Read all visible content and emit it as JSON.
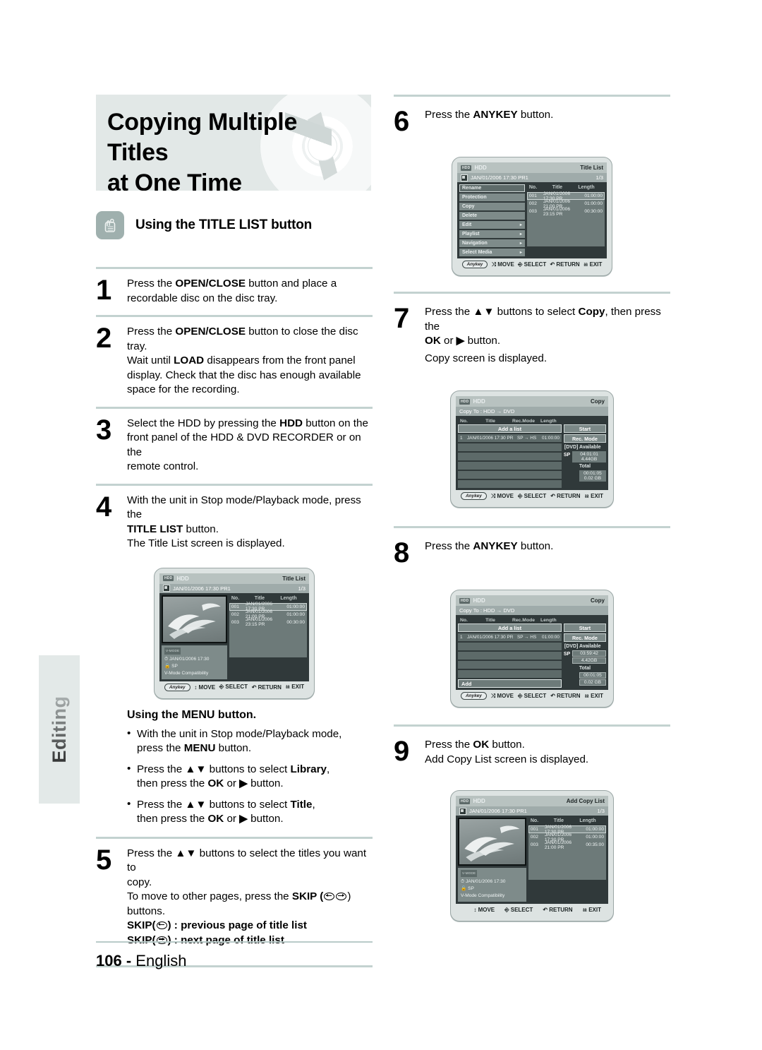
{
  "page": {
    "side_tab_label": "Editing",
    "footer_page": "106 -",
    "footer_lang": "English"
  },
  "banner": {
    "title_line1": "Copying Multiple Titles",
    "title_line2": "at One Time"
  },
  "section": {
    "icon": "hand-press-icon",
    "title": "Using the TITLE LIST button"
  },
  "steps_left": [
    {
      "num": "1",
      "lines": [
        [
          {
            "t": "Press the "
          },
          {
            "t": "OPEN/CLOSE",
            "b": true
          },
          {
            "t": " button and place a"
          }
        ],
        [
          {
            "t": "recordable disc on the disc tray."
          }
        ]
      ]
    },
    {
      "num": "2",
      "lines": [
        [
          {
            "t": "Press the "
          },
          {
            "t": "OPEN/CLOSE",
            "b": true
          },
          {
            "t": " button to close the disc tray."
          }
        ],
        [
          {
            "t": "Wait until "
          },
          {
            "t": "LOAD",
            "b": true
          },
          {
            "t": " disappears from the front panel"
          }
        ],
        [
          {
            "t": "display. Check that the disc has enough available"
          }
        ],
        [
          {
            "t": "space for the recording."
          }
        ]
      ]
    },
    {
      "num": "3",
      "lines": [
        [
          {
            "t": "Select the HDD by pressing the "
          },
          {
            "t": "HDD",
            "b": true
          },
          {
            "t": " button on the"
          }
        ],
        [
          {
            "t": "front panel of the HDD & DVD RECORDER or on the"
          }
        ],
        [
          {
            "t": "remote control."
          }
        ]
      ]
    },
    {
      "num": "4",
      "lines": [
        [
          {
            "t": "With the unit in Stop mode/Playback mode, press the"
          }
        ],
        [
          {
            "t": "TITLE LIST",
            "b": true
          },
          {
            "t": " button."
          }
        ],
        [
          {
            "t": "The Title List screen is displayed."
          }
        ]
      ]
    }
  ],
  "menu_section": {
    "heading": "Using the MENU button.",
    "bullets": [
      [
        {
          "t": "With the unit in Stop mode/Playback mode,"
        },
        {
          "br": true
        },
        {
          "t": "press the "
        },
        {
          "t": "MENU",
          "b": true
        },
        {
          "t": " button."
        }
      ],
      [
        {
          "t": "Press the "
        },
        {
          "t": "▲▼",
          "b": true
        },
        {
          "t": " buttons to select "
        },
        {
          "t": "Library",
          "b": true
        },
        {
          "t": ","
        },
        {
          "br": true
        },
        {
          "t": "then press the "
        },
        {
          "t": "OK",
          "b": true
        },
        {
          "t": " or "
        },
        {
          "t": "▶",
          "b": true
        },
        {
          "t": " button."
        }
      ],
      [
        {
          "t": "Press the "
        },
        {
          "t": "▲▼",
          "b": true
        },
        {
          "t": " buttons to select "
        },
        {
          "t": "Title",
          "b": true
        },
        {
          "t": ","
        },
        {
          "br": true
        },
        {
          "t": "then press the "
        },
        {
          "t": "OK",
          "b": true
        },
        {
          "t": " or "
        },
        {
          "t": "▶",
          "b": true
        },
        {
          "t": " button."
        }
      ]
    ]
  },
  "step5": {
    "num": "5",
    "l1a": "Press the ",
    "l1b": "▲▼",
    "l1c": " buttons to select the titles you want to",
    "l2": "copy.",
    "l3a": "To move to other pages, press the ",
    "l3b": "SKIP (",
    "l3c": ")",
    "l4": "buttons.",
    "l5a": "SKIP(",
    "l5b": ") : previous page of title list",
    "l6a": "SKIP(",
    "l6b": ") : next page of title list"
  },
  "steps_right": [
    {
      "num": "6",
      "lines": [
        [
          {
            "t": "Press the "
          },
          {
            "t": "ANYKEY",
            "b": true
          },
          {
            "t": " button."
          }
        ]
      ]
    },
    {
      "num": "7",
      "lines": [
        [
          {
            "t": "Press the "
          },
          {
            "t": "▲▼",
            "b": true
          },
          {
            "t": " buttons to select "
          },
          {
            "t": "Copy",
            "b": true
          },
          {
            "t": ", then press the"
          }
        ],
        [
          {
            "t": "OK",
            "b": true
          },
          {
            "t": " or "
          },
          {
            "t": "▶",
            "b": true
          },
          {
            "t": " button."
          }
        ],
        [
          {
            "t": "Copy screen is displayed."
          }
        ]
      ]
    },
    {
      "num": "8",
      "lines": [
        [
          {
            "t": "Press the "
          },
          {
            "t": "ANYKEY",
            "b": true
          },
          {
            "t": " button."
          }
        ]
      ]
    },
    {
      "num": "9",
      "lines": [
        [
          {
            "t": "Press the "
          },
          {
            "t": "OK",
            "b": true
          },
          {
            "t": " button."
          }
        ],
        [
          {
            "t": "Add Copy List screen is displayed."
          }
        ]
      ]
    }
  ],
  "osd_common": {
    "source": "HDD",
    "subtitle": "JAN/01/2006 17:30 PR1",
    "page_indicator": "1/3",
    "col_no": "No.",
    "col_title": "Title",
    "col_length": "Length",
    "anykey": "Anykey",
    "move": "MOVE",
    "select": "SELECT",
    "return": "RETURN",
    "exit": "EXIT",
    "vmode_chip": "V-MODE",
    "info_time": "JAN/01/2006 17:30",
    "info_rec": "SP",
    "info_compat": "V-Mode Compatibility"
  },
  "osd_titlelist": {
    "title": "Title List",
    "rows": [
      {
        "no": "001",
        "title": "JAN/01/2006 17:30 PR",
        "length": "01:00:00",
        "selected": true
      },
      {
        "no": "002",
        "title": "JAN/01/2006 21:00 PR",
        "length": "01:00:00",
        "selected": false
      },
      {
        "no": "003",
        "title": "JAN/01/2006 23:15 PR",
        "length": "00:30:00",
        "selected": false
      }
    ],
    "empty_rows": 4
  },
  "osd_anykey_menu": {
    "title": "Title List",
    "items": [
      {
        "label": "Rename",
        "arrow": false,
        "selected": true
      },
      {
        "label": "Protection",
        "arrow": false,
        "selected": false
      },
      {
        "label": "Copy",
        "arrow": false,
        "selected": false
      },
      {
        "label": "Delete",
        "arrow": false,
        "selected": false
      },
      {
        "label": "Edit",
        "arrow": true,
        "selected": false
      },
      {
        "label": "Playlist",
        "arrow": true,
        "selected": false
      },
      {
        "label": "Navigation",
        "arrow": true,
        "selected": false
      },
      {
        "label": "Select Media",
        "arrow": true,
        "selected": false
      }
    ],
    "rows": [
      {
        "no": "001",
        "title": "JAN/01/2006 17:30 PR",
        "length": "01:00:00",
        "selected": true
      },
      {
        "no": "002",
        "title": "JAN/01/2006 21:00 PR",
        "length": "01:00:00",
        "selected": false
      },
      {
        "no": "003",
        "title": "JAN/01/2006 23:15 PR",
        "length": "00:30:00",
        "selected": false
      }
    ],
    "empty_rows": 4
  },
  "osd_copy_7": {
    "title": "Copy",
    "copy_to": "Copy To : HDD → DVD",
    "col_no": "No.",
    "col_title": "Title",
    "col_recmode": "Rec.Mode",
    "col_length": "Length",
    "add_a_list": "Add a list",
    "item": {
      "no": "1",
      "title": "JAN/01/2006 17:30 PR",
      "recmode": "SP → HS",
      "length": "01:00:00"
    },
    "btn_start": "Start",
    "btn_recmode": "Rec. Mode",
    "available_label": "[DVD] Available",
    "available_mode": "SP",
    "available_time": "04:01:01",
    "available_size": "4.44GB",
    "total_label": "Total",
    "total_time": "00:01:05",
    "total_size": "0.02 GB",
    "blank_rows": 5
  },
  "osd_copy_8": {
    "title": "Copy",
    "copy_to": "Copy To : HDD → DVD",
    "col_no": "No.",
    "col_title": "Title",
    "col_recmode": "Rec.Mode",
    "col_length": "Length",
    "add_a_list": "Add a list",
    "item": {
      "no": "1",
      "title": "JAN/01/2006 17:30 PR",
      "recmode": "SP → HS",
      "length": "01:00:00"
    },
    "btn_start": "Start",
    "btn_recmode": "Rec. Mode",
    "available_label": "[DVD] Available",
    "available_mode": "SP",
    "available_time": "03:59:42",
    "available_size": "4.42GB",
    "total_label": "Total",
    "total_time": "00:01:05",
    "total_size": "0.02 GB",
    "add_popup": "Add",
    "blank_rows": 4
  },
  "osd_addcopylist": {
    "title": "Add Copy List",
    "rows": [
      {
        "no": "001",
        "title": "JAN/01/2006 17:30 PR",
        "length": "01:00:00",
        "selected": true
      },
      {
        "no": "002",
        "title": "JAN/01/2006 17:30 PR",
        "length": "01:00:00",
        "selected": false
      },
      {
        "no": "003",
        "title": "JAN/01/2006 21:00 PR",
        "length": "00:35:00",
        "selected": false
      }
    ],
    "empty_rows": 4
  },
  "colors": {
    "banner_bg": "#e2e8e7",
    "rule": "#c3d2d0",
    "icon_bg": "#9fb0ae",
    "osd_frame": "#dde3e2",
    "osd_stage": "#30393a"
  }
}
